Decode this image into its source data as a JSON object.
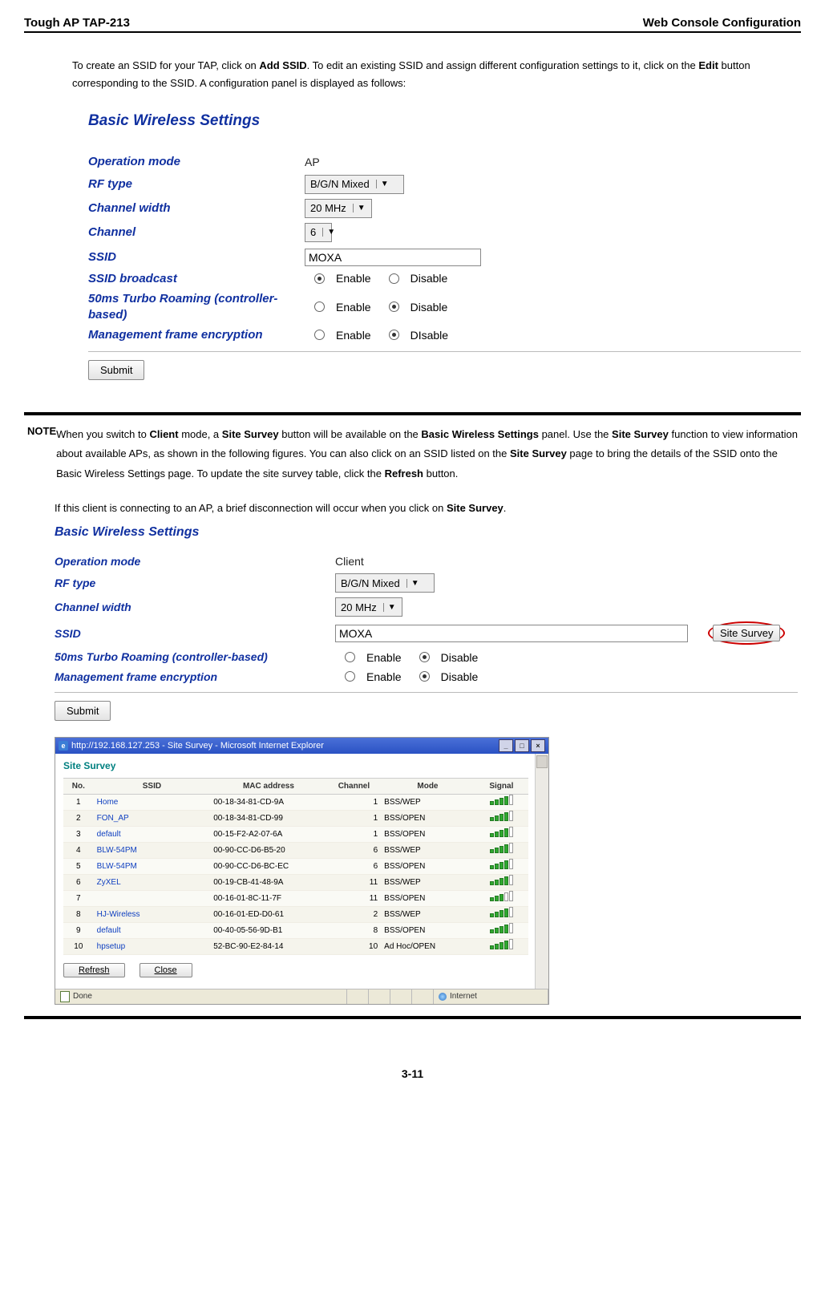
{
  "header": {
    "left": "Tough AP TAP-213",
    "right": "Web Console Configuration"
  },
  "intro": {
    "t1": "To create an SSID for your TAP, click on ",
    "b1": "Add SSID",
    "t2": ". To edit an existing SSID and assign different configuration settings to it, click on the ",
    "b2": "Edit",
    "t3": " button corresponding to the SSID. A configuration panel is displayed as follows:"
  },
  "panel1": {
    "title": "Basic Wireless Settings",
    "labels": {
      "op": "Operation mode",
      "rf": "RF type",
      "cw": "Channel width",
      "ch": "Channel",
      "ssid": "SSID",
      "bcast": "SSID broadcast",
      "turbo": "50ms Turbo Roaming (controller-based)",
      "mfe": "Management frame encryption"
    },
    "values": {
      "op": "AP",
      "rf": "B/G/N Mixed",
      "cw": "20 MHz",
      "ch": "6",
      "ssid": "MOXA"
    },
    "radio": {
      "enable": "Enable",
      "disable": "Disable",
      "disable2": "DIsable"
    },
    "submit": "Submit"
  },
  "note": {
    "label": "NOTE",
    "t1": "When you switch to ",
    "b1": "Client",
    "t2": " mode, a ",
    "b2": "Site Survey",
    "t3": " button will be available on the ",
    "b3": "Basic Wireless Settings",
    "t4": " panel. Use the ",
    "b4": "Site Survey",
    "t5": " function to view information about available APs, as shown in the following figures. You can also click on an SSID listed on the ",
    "b5": "Site Survey",
    "t6": " page to bring the details of the SSID onto the Basic Wireless Settings page. To update the site survey table, click the ",
    "b6": "Refresh",
    "t7": " button.",
    "sub1": "If this client is connecting to an AP, a brief disconnection will occur when you click on ",
    "sub_b": "Site Survey",
    "sub2": "."
  },
  "panel2": {
    "title": "Basic Wireless Settings",
    "labels": {
      "op": "Operation mode",
      "rf": "RF type",
      "cw": "Channel width",
      "ssid": "SSID",
      "turbo": "50ms Turbo Roaming (controller-based)",
      "mfe": "Management frame encryption"
    },
    "values": {
      "op": "Client",
      "rf": "B/G/N Mixed",
      "cw": "20 MHz",
      "ssid": "MOXA"
    },
    "radio": {
      "enable": "Enable",
      "disable": "Disable"
    },
    "ssbtn": "Site Survey",
    "submit": "Submit"
  },
  "ie": {
    "title": "http://192.168.127.253 - Site Survey - Microsoft Internet Explorer",
    "survey_title": "Site Survey",
    "cols": {
      "no": "No.",
      "ssid": "SSID",
      "mac": "MAC address",
      "ch": "Channel",
      "mode": "Mode",
      "sig": "Signal"
    },
    "rows": [
      {
        "no": "1",
        "ssid": "Home",
        "mac": "00-18-34-81-CD-9A",
        "ch": "1",
        "mode": "BSS/WEP",
        "sig": 4
      },
      {
        "no": "2",
        "ssid": "FON_AP",
        "mac": "00-18-34-81-CD-99",
        "ch": "1",
        "mode": "BSS/OPEN",
        "sig": 4
      },
      {
        "no": "3",
        "ssid": "default",
        "mac": "00-15-F2-A2-07-6A",
        "ch": "1",
        "mode": "BSS/OPEN",
        "sig": 4
      },
      {
        "no": "4",
        "ssid": "BLW-54PM",
        "mac": "00-90-CC-D6-B5-20",
        "ch": "6",
        "mode": "BSS/WEP",
        "sig": 4
      },
      {
        "no": "5",
        "ssid": "BLW-54PM",
        "mac": "00-90-CC-D6-BC-EC",
        "ch": "6",
        "mode": "BSS/OPEN",
        "sig": 4
      },
      {
        "no": "6",
        "ssid": "ZyXEL",
        "mac": "00-19-CB-41-48-9A",
        "ch": "11",
        "mode": "BSS/WEP",
        "sig": 4
      },
      {
        "no": "7",
        "ssid": "",
        "mac": "00-16-01-8C-11-7F",
        "ch": "11",
        "mode": "BSS/OPEN",
        "sig": 3
      },
      {
        "no": "8",
        "ssid": "HJ-Wireless",
        "mac": "00-16-01-ED-D0-61",
        "ch": "2",
        "mode": "BSS/WEP",
        "sig": 4
      },
      {
        "no": "9",
        "ssid": "default",
        "mac": "00-40-05-56-9D-B1",
        "ch": "8",
        "mode": "BSS/OPEN",
        "sig": 4
      },
      {
        "no": "10",
        "ssid": "hpsetup",
        "mac": "52-BC-90-E2-84-14",
        "ch": "10",
        "mode": "Ad Hoc/OPEN",
        "sig": 4
      }
    ],
    "refresh": "Refresh",
    "close": "Close",
    "done": "Done",
    "internet": "Internet"
  },
  "pagenum": "3-11"
}
